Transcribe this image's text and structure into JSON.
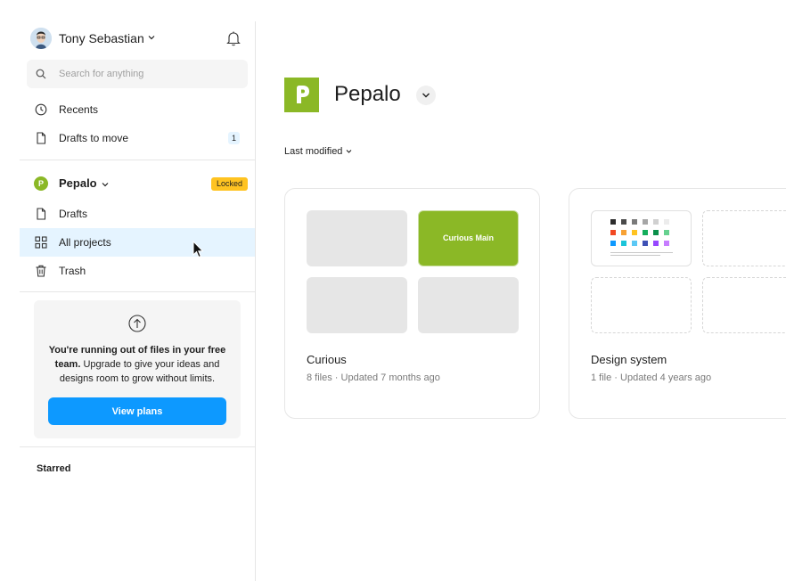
{
  "user": {
    "name": "Tony Sebastian"
  },
  "search": {
    "placeholder": "Search for anything"
  },
  "nav": {
    "recents": "Recents",
    "drafts_to_move": "Drafts to move",
    "drafts_to_move_count": "1"
  },
  "team": {
    "name": "Pepalo",
    "logo_letter": "P",
    "badge": "Locked",
    "items": [
      {
        "label": "Drafts"
      },
      {
        "label": "All projects"
      },
      {
        "label": "Trash"
      }
    ]
  },
  "upsell": {
    "bold_text": "You're running out of files in your free team.",
    "text": " Upgrade to give your ideas and designs room to grow without limits.",
    "button": "View plans"
  },
  "starred": "Starred",
  "main": {
    "title": "Pepalo",
    "sort_label": "Last modified",
    "projects": [
      {
        "title": "Curious",
        "meta": "8 files · Updated 7 months ago",
        "thumb_label": "Curious Main"
      },
      {
        "title": "Design system",
        "meta": "1 file · Updated 4 years ago"
      }
    ]
  },
  "colors": {
    "accent": "#0d99ff",
    "brand_green": "#8bb826",
    "locked_yellow": "#ffc321",
    "active_bg": "#e5f4ff"
  }
}
